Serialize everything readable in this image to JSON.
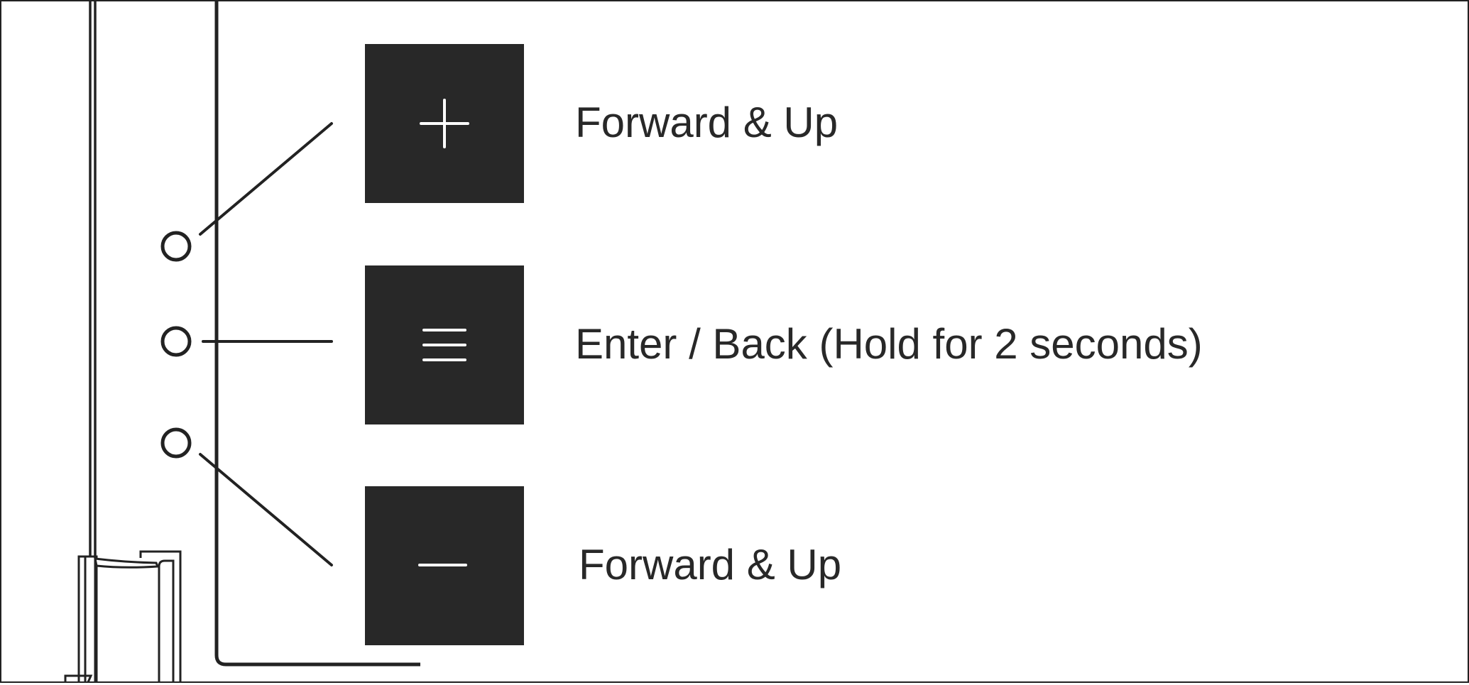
{
  "buttons": [
    {
      "id": "up",
      "icon": "plus-icon",
      "label": "Forward & Up"
    },
    {
      "id": "menu",
      "icon": "menu-lines-icon",
      "label": "Enter / Back (Hold for 2 seconds)"
    },
    {
      "id": "down",
      "icon": "minus-icon",
      "label": "Forward & Up"
    }
  ],
  "colors": {
    "ink": "#282828",
    "tile": "#282828",
    "glyph": "#ffffff",
    "background": "#ffffff"
  }
}
